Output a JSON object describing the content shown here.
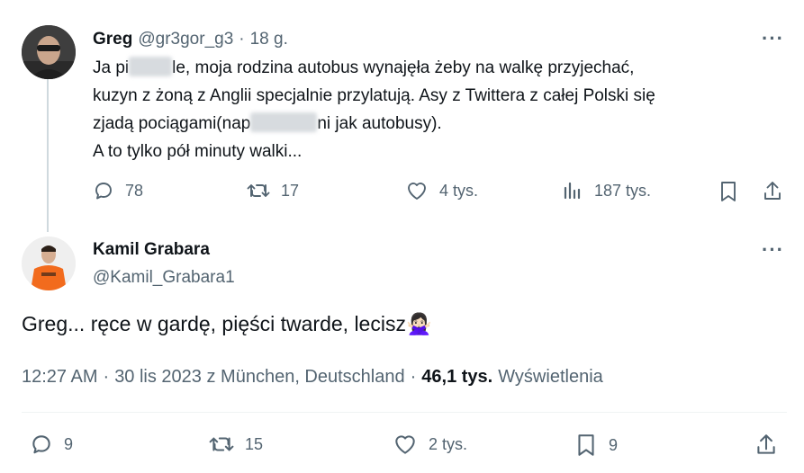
{
  "tweet1": {
    "name": "Greg",
    "handle": "@gr3gor_g3",
    "separator": "·",
    "time": "18 g.",
    "more": "···",
    "line1a": "Ja pi",
    "line1b": "le, moja rodzina autobus wynajęła żeby na walkę przyjechać,",
    "line2": "kuzyn z żoną z Anglii specjalnie przylatują. Asy z Twittera z całej Polski się",
    "line3a": "zjadą pociągami(nap",
    "line3b": "ni jak autobusy).",
    "line4": "A to tylko pół minuty walki...",
    "replies": "78",
    "retweets": "17",
    "likes": "4 tys.",
    "views": "187 tys."
  },
  "tweet2": {
    "name": "Kamil Grabara",
    "handle": "@Kamil_Grabara1",
    "more": "···",
    "text": "Greg... ręce w gardę, pięści twarde, lecisz",
    "emoji": "🙅🏻‍♀️",
    "time": "12:27 AM",
    "dot1": "·",
    "date": "30 lis 2023 z München, Deutschland",
    "dot2": "·",
    "views_count": "46,1 tys.",
    "views_label": "Wyświetlenia",
    "replies": "9",
    "retweets": "15",
    "likes": "2 tys.",
    "bookmarks": "9"
  },
  "colors": {
    "text": "#0f1419",
    "muted": "#536471",
    "divider": "#eff3f4",
    "thread_line": "#cfd9de",
    "shirt_orange": "#f26b1d"
  }
}
